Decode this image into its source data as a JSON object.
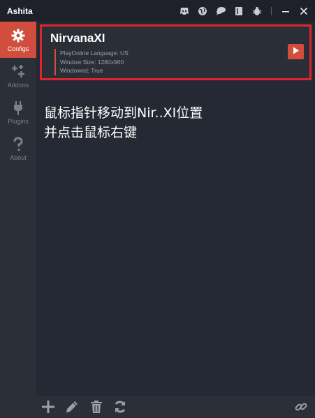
{
  "app": {
    "title": "Ashita"
  },
  "titlebar_icons": [
    "discord-icon",
    "globe-icon",
    "chat-icon",
    "book-icon",
    "bug-icon",
    "minimize-icon",
    "close-icon"
  ],
  "sidebar": {
    "items": [
      {
        "label": "Configs",
        "icon": "gear-icon",
        "active": true
      },
      {
        "label": "Addons",
        "icon": "puzzle-plus-icon",
        "active": false
      },
      {
        "label": "Plugins",
        "icon": "plug-icon",
        "active": false
      },
      {
        "label": "About",
        "icon": "question-icon",
        "active": false
      }
    ]
  },
  "config": {
    "name": "NirvanaXI",
    "details": [
      "PlayOnline Language: US",
      "Window Size: 1280x960",
      "Windowed: True"
    ]
  },
  "instruction": {
    "line1": "鼠标指针移动到Nir..XI位置",
    "line2": "并点击鼠标右键"
  },
  "bottombar_icons": [
    "add-icon",
    "edit-icon",
    "delete-icon",
    "refresh-icon",
    "link-icon"
  ],
  "colors": {
    "accent": "#d14d3d",
    "highlight": "#e0242b",
    "bg": "#252933"
  }
}
